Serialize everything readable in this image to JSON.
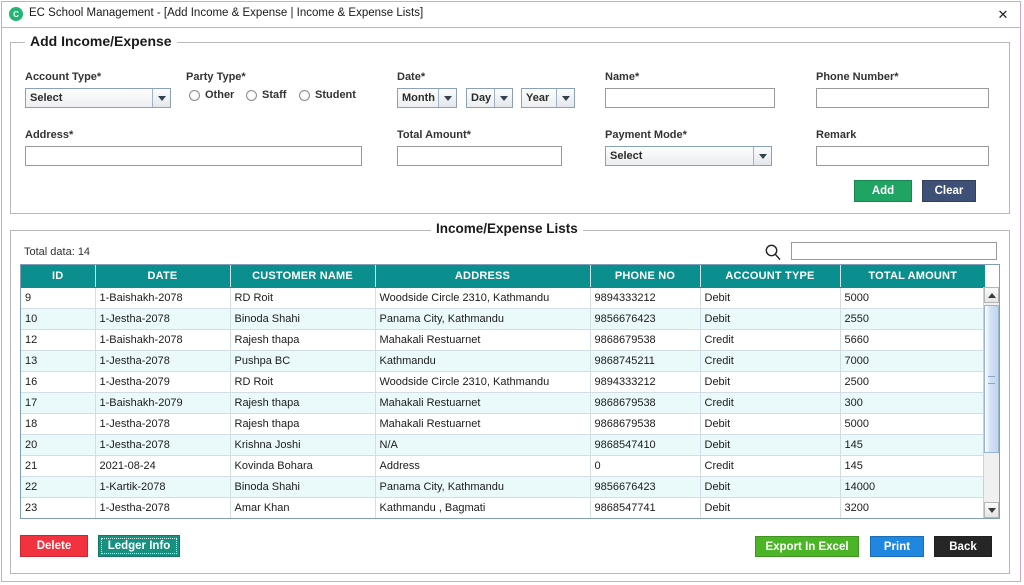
{
  "window": {
    "title": "EC School Management - [Add Income & Expense | Income & Expense Lists]",
    "app_icon": "ec-logo-icon",
    "close_icon": "✕",
    "border_color": "#d9a6bb"
  },
  "form": {
    "legend": "Add Income/Expense",
    "account_type": {
      "label": "Account Type*",
      "value": "Select"
    },
    "party_type": {
      "label": "Party Type*",
      "options": [
        "Other",
        "Staff",
        "Student"
      ],
      "selected": ""
    },
    "date": {
      "label": "Date*",
      "month": "Month",
      "day": "Day",
      "year": "Year"
    },
    "name": {
      "label": "Name*",
      "value": "",
      "placeholder": ""
    },
    "phone_number": {
      "label": "Phone Number*",
      "value": "",
      "placeholder": ""
    },
    "address": {
      "label": "Address*",
      "value": "",
      "placeholder": ""
    },
    "total_amount": {
      "label": "Total Amount*",
      "value": "",
      "placeholder": ""
    },
    "payment_mode": {
      "label": "Payment Mode*",
      "value": "Select"
    },
    "remark": {
      "label": "Remark",
      "value": "",
      "placeholder": ""
    },
    "add_label": "Add",
    "clear_label": "Clear",
    "add_color": "#1fa463",
    "clear_color": "#3f5077"
  },
  "list": {
    "legend": "Income/Expense Lists",
    "total_data": "Total data: 14",
    "search_icon": "search-icon",
    "search_value": "",
    "search_placeholder": "",
    "header_color": "#0b8e8e",
    "columns": [
      "ID",
      "DATE",
      "CUSTOMER NAME",
      "ADDRESS",
      "PHONE NO",
      "ACCOUNT TYPE",
      "TOTAL AMOUNT"
    ],
    "rows": [
      [
        "9",
        "1-Baishakh-2078",
        "RD Roit",
        "Woodside Circle 2310, Kathmandu",
        "9894333212",
        "Debit",
        "5000"
      ],
      [
        "10",
        "1-Jestha-2078",
        "Binoda Shahi",
        "Panama City, Kathmandu",
        "9856676423",
        "Debit",
        "2550"
      ],
      [
        "12",
        "1-Baishakh-2078",
        "Rajesh thapa",
        "Mahakali Restuarnet",
        "9868679538",
        "Credit",
        "5660"
      ],
      [
        "13",
        "1-Jestha-2078",
        "Pushpa BC",
        "Kathmandu",
        "9868745211",
        "Credit",
        "7000"
      ],
      [
        "16",
        "1-Jestha-2079",
        "RD Roit",
        "Woodside Circle 2310, Kathmandu",
        "9894333212",
        "Debit",
        "2500"
      ],
      [
        "17",
        "1-Baishakh-2079",
        "Rajesh thapa",
        "Mahakali Restuarnet",
        "9868679538",
        "Credit",
        "300"
      ],
      [
        "18",
        "1-Jestha-2078",
        "Rajesh thapa",
        "Mahakali Restuarnet",
        "9868679538",
        "Debit",
        "5000"
      ],
      [
        "20",
        "1-Jestha-2078",
        "Krishna Joshi",
        "N/A",
        "9868547410",
        "Debit",
        "145"
      ],
      [
        "21",
        "2021-08-24",
        "Kovinda Bohara",
        "Address",
        "0",
        "Credit",
        "145"
      ],
      [
        "22",
        "1-Kartik-2078",
        "Binoda Shahi",
        "Panama City, Kathmandu",
        "9856676423",
        "Debit",
        "14000"
      ],
      [
        "23",
        "1-Jestha-2078",
        "Amar Khan",
        "Kathmandu , Bagmati",
        "9868547741",
        "Debit",
        "3200"
      ]
    ],
    "scrollbar": {
      "up_icon": "caret-up-icon",
      "down_icon": "caret-down-icon"
    }
  },
  "footer": {
    "delete_label": "Delete",
    "ledger_label": "Ledger Info",
    "export_label": "Export In Excel",
    "print_label": "Print",
    "back_label": "Back",
    "delete_color": "#f2323f",
    "ledger_color": "#18907f",
    "export_color": "#4cb527",
    "print_color": "#2087e0",
    "back_color": "#262626"
  }
}
